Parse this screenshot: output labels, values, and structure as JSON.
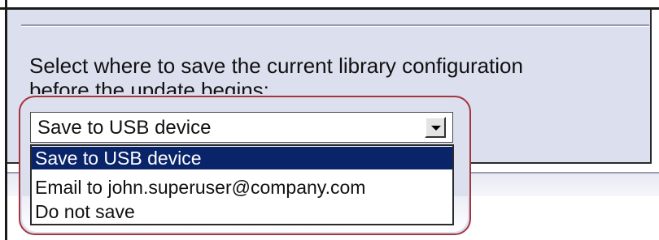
{
  "dialog": {
    "prompt_line1": "Select where to save the current library configuration",
    "prompt_line2": "before the update begins:"
  },
  "save_location": {
    "selected_value": "Save to USB device",
    "arrow_icon": "chevron-down-icon",
    "options": [
      {
        "label": "Save to USB device",
        "highlighted": true
      },
      {
        "label": "Email to john.superuser@company.com",
        "highlighted": false
      },
      {
        "label": "Do not save",
        "highlighted": false
      }
    ]
  },
  "colors": {
    "panel_background": "#dcdfee",
    "highlight_callout": "#a6343c",
    "selection_background": "#0a246a"
  }
}
